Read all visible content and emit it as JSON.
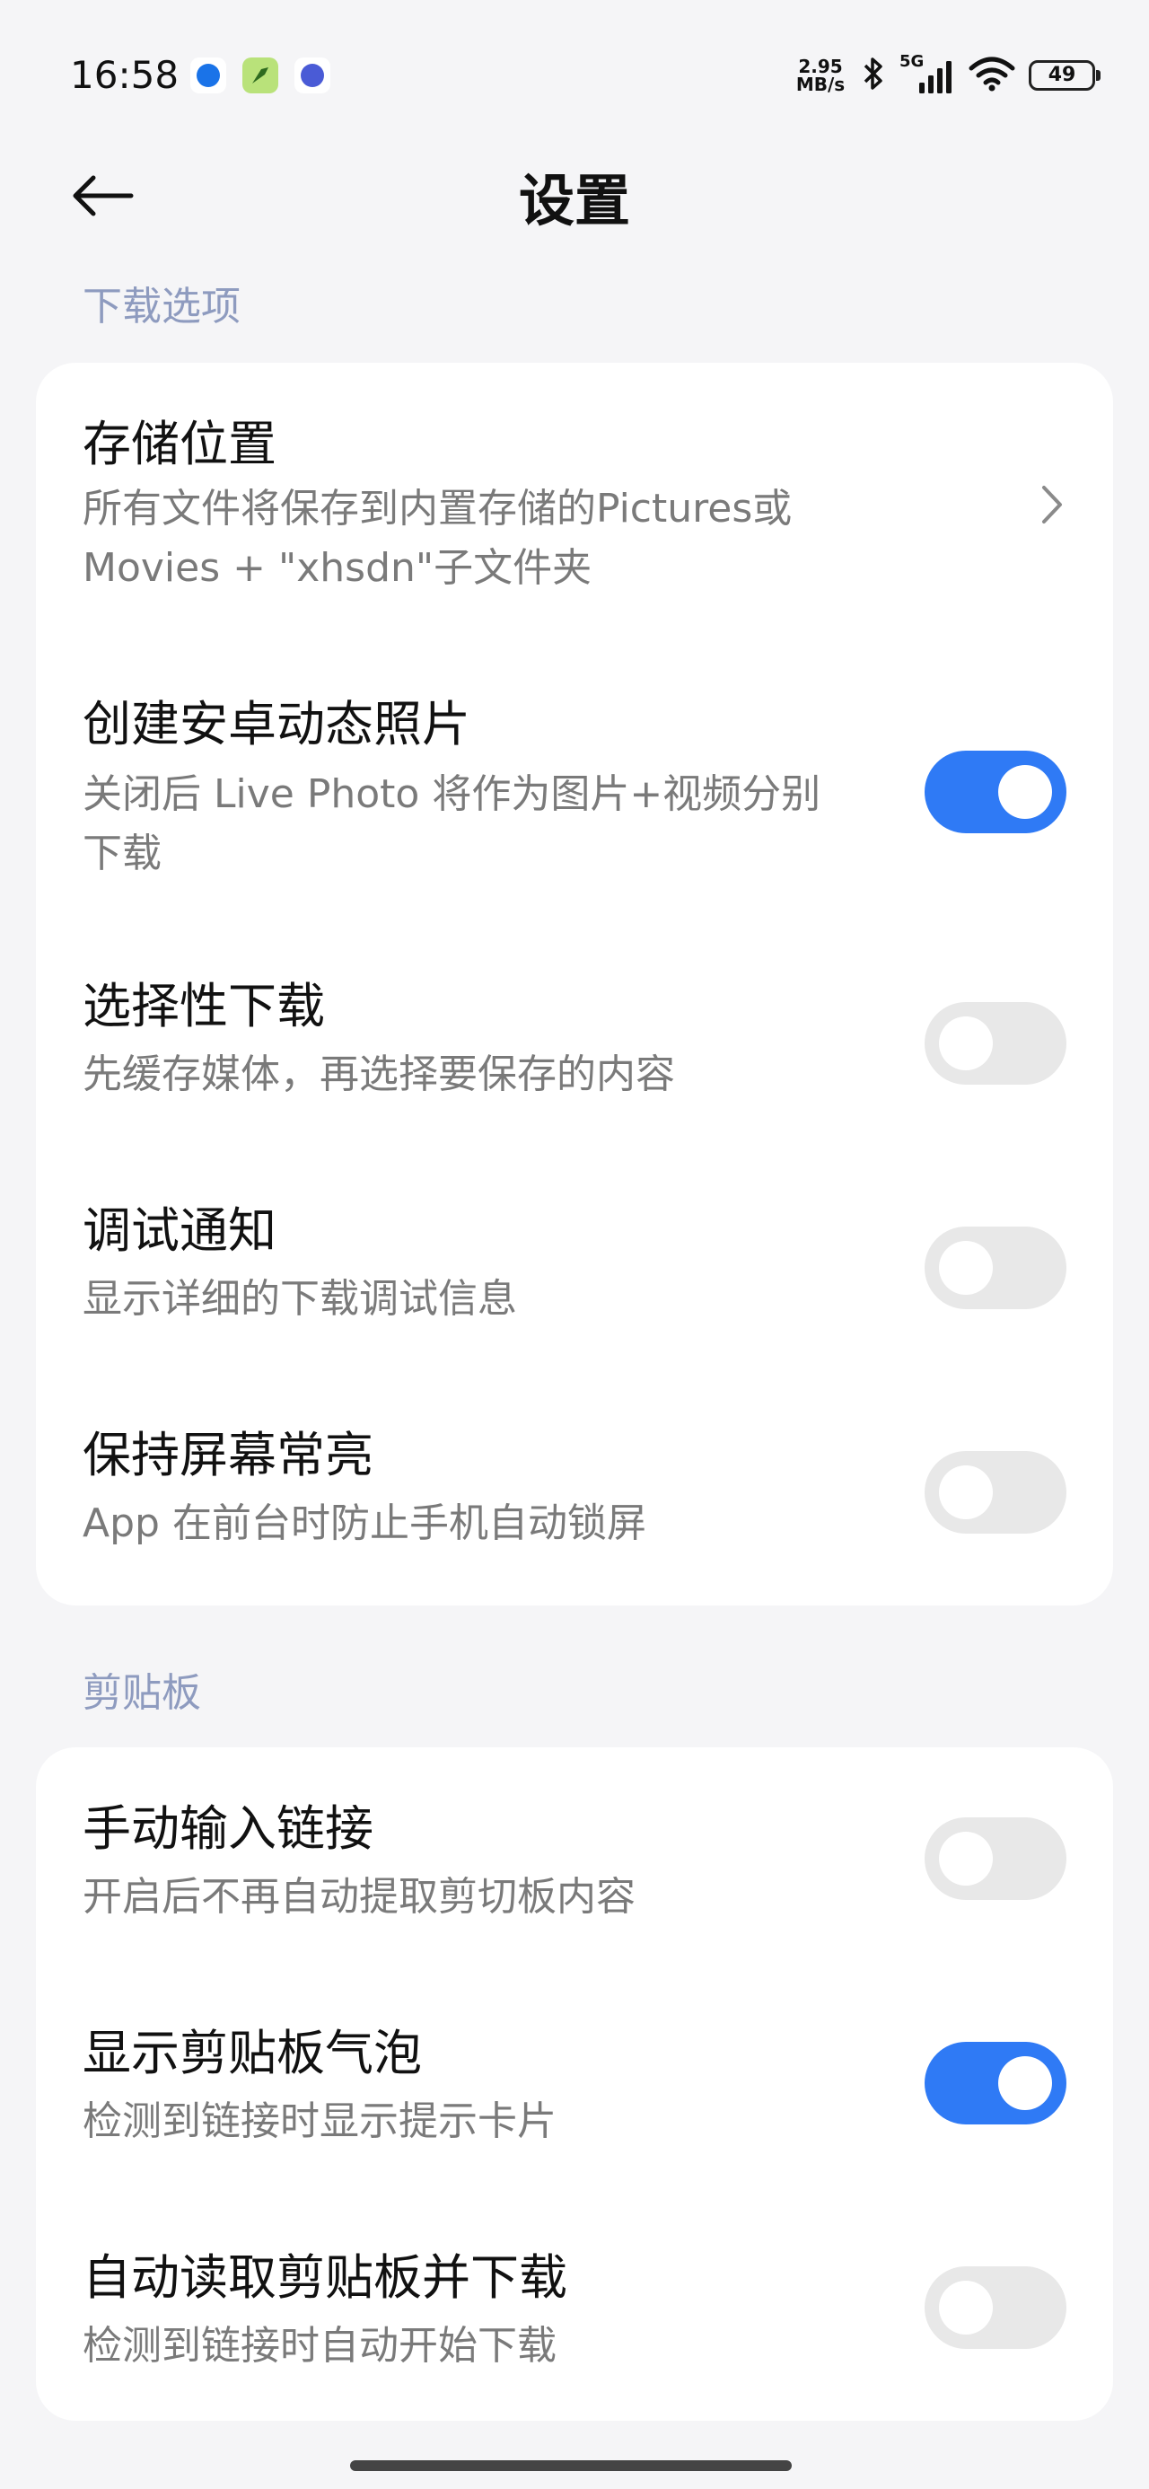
{
  "status_bar": {
    "time": "16:58",
    "net_speed_value": "2.95",
    "net_speed_unit": "MB/s",
    "signal_label": "5G",
    "battery": "49"
  },
  "header": {
    "title": "设置"
  },
  "sections": {
    "download": {
      "label": "下载选项",
      "rows": {
        "storage": {
          "title": "存储位置",
          "subtitle_line1": "所有文件将保存到内置存储的Pictures或",
          "subtitle_line2": "Movies + \"xhsdn\"子文件夹"
        },
        "live_photo": {
          "title": "创建安卓动态照片",
          "subtitle_line1": "关闭后 Live Photo 将作为图片+视频分别",
          "subtitle_line2": "下载",
          "enabled": true
        },
        "selective": {
          "title": "选择性下载",
          "subtitle": "先缓存媒体，再选择要保存的内容",
          "enabled": false
        },
        "debug": {
          "title": "调试通知",
          "subtitle": "显示详细的下载调试信息",
          "enabled": false
        },
        "screen_on": {
          "title": "保持屏幕常亮",
          "subtitle": "App 在前台时防止手机自动锁屏",
          "enabled": false
        }
      }
    },
    "clipboard": {
      "label": "剪贴板",
      "rows": {
        "manual_link": {
          "title": "手动输入链接",
          "subtitle": "开启后不再自动提取剪切板内容",
          "enabled": false
        },
        "bubble": {
          "title": "显示剪贴板气泡",
          "subtitle": "检测到链接时显示提示卡片",
          "enabled": true
        },
        "auto_read": {
          "title": "自动读取剪贴板并下载",
          "subtitle": "检测到链接时自动开始下载",
          "enabled": false
        }
      }
    }
  },
  "colors": {
    "accent": "#2f7af5",
    "section_label": "#8e9bbf",
    "background": "#f5f5f7",
    "toggle_off": "#e8e8e8"
  },
  "icons": {
    "back": "arrow-left-icon",
    "chevron": "chevron-right-icon",
    "bluetooth": "bluetooth-icon",
    "signal": "signal-bars-icon",
    "wifi": "wifi-icon",
    "battery": "battery-icon"
  }
}
